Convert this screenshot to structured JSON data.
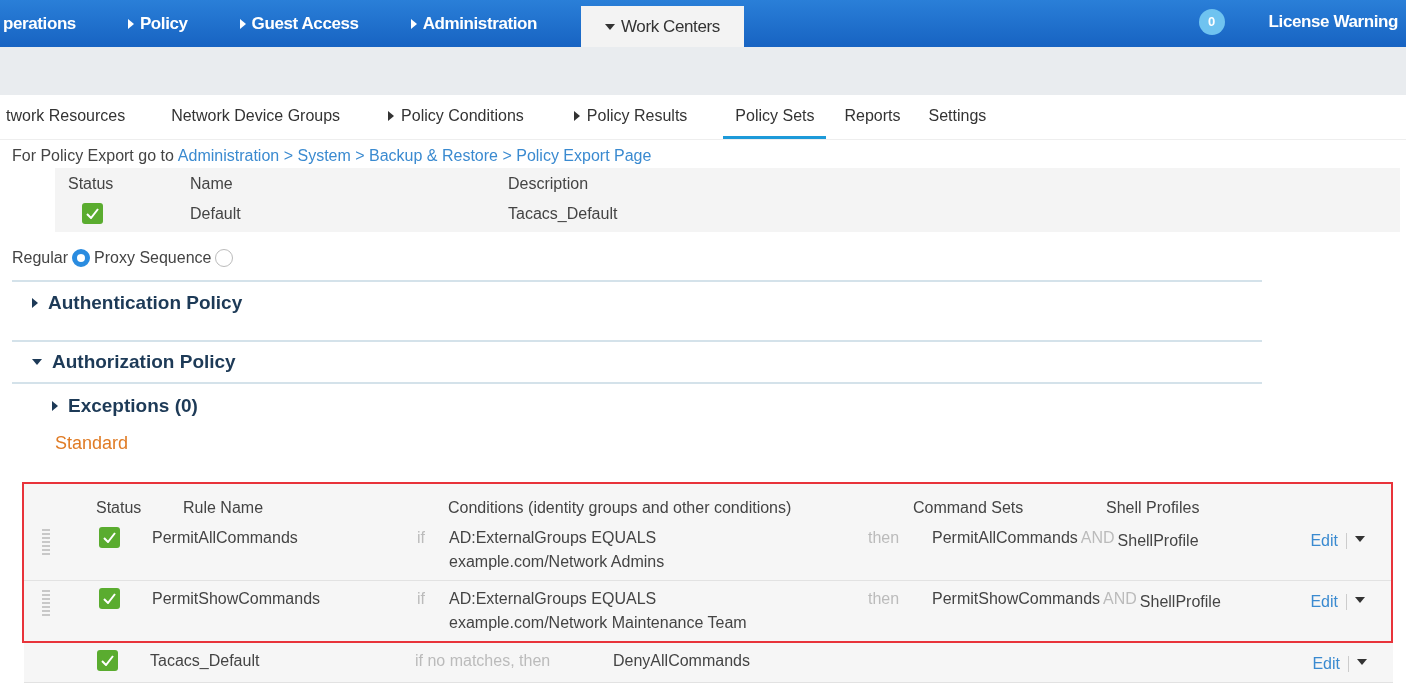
{
  "top_nav": {
    "items": [
      {
        "label": "perations",
        "selected": false
      },
      {
        "label": "Policy",
        "expanded": false,
        "selected": false
      },
      {
        "label": "Guest Access",
        "expanded": false,
        "selected": false
      },
      {
        "label": "Administration",
        "expanded": false,
        "selected": false
      },
      {
        "label": "Work Centers",
        "expanded": true,
        "selected": true
      }
    ],
    "notification_count": "0",
    "license_warning": "License Warning"
  },
  "sub_nav": {
    "tabs": [
      {
        "label": "twork Resources",
        "selected": false
      },
      {
        "label": "Network Device Groups",
        "selected": false
      },
      {
        "label": "Policy Conditions",
        "expanded": false,
        "selected": false
      },
      {
        "label": "Policy Results",
        "expanded": false,
        "selected": false
      },
      {
        "label": "Policy Sets",
        "selected": true
      },
      {
        "label": "Reports",
        "selected": false
      },
      {
        "label": "Settings",
        "selected": false
      }
    ]
  },
  "export_note": {
    "text": "For Policy Export go to",
    "link": "Administration > System > Backup & Restore > Policy Export Page"
  },
  "policy_set": {
    "columns": [
      "Status",
      "Name",
      "Description"
    ],
    "row": {
      "enabled": true,
      "name": "Default",
      "description": "Tacacs_Default"
    }
  },
  "mode": [
    {
      "label": "Regular",
      "selected": true
    },
    {
      "label": "Proxy Sequence",
      "selected": false
    }
  ],
  "sections": [
    {
      "title": "Authentication Policy",
      "expanded": false
    },
    {
      "title": "Authorization Policy",
      "expanded": true
    }
  ],
  "exceptions": {
    "title": "Exceptions (0)",
    "expanded": false
  },
  "standard_label": "Standard",
  "rules": {
    "highlighted": true,
    "columns": [
      "Status",
      "Rule Name",
      "Conditions (identity groups and other conditions)",
      "Command Sets",
      "Shell Profiles"
    ],
    "rows": [
      {
        "enabled": true,
        "name": "PermitAllCommands",
        "if": "if",
        "conditions": [
          "AD:ExternalGroups EQUALS",
          "example.com/Network Admins"
        ],
        "then": "then",
        "command_set": "PermitAllCommands",
        "and": "AND",
        "shell_profile": "ShellProfile",
        "edit": "Edit"
      },
      {
        "enabled": true,
        "name": "PermitShowCommands",
        "if": "if",
        "conditions": [
          "AD:ExternalGroups EQUALS",
          "example.com/Network Maintenance Team"
        ],
        "then": "then",
        "command_set": "PermitShowCommands",
        "and": "AND",
        "shell_profile": "ShellProfile",
        "edit": "Edit"
      }
    ],
    "default_row": {
      "enabled": true,
      "name": "Tacacs_Default",
      "fallback": "if no matches, then",
      "command_set": "DenyAllCommands",
      "edit": "Edit"
    }
  }
}
